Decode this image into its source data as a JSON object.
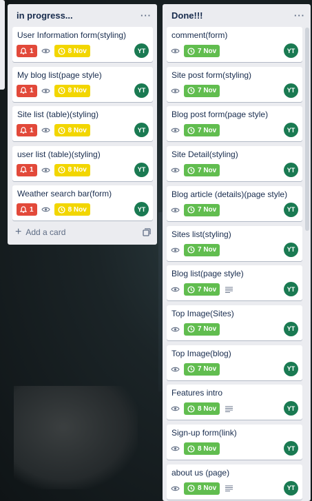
{
  "lists": [
    {
      "title": "in progress...",
      "add_card_label": "Add a card",
      "cards": [
        {
          "title": "User Information form(styling)",
          "notifications": "1",
          "due": "8 Nov",
          "due_color": "yellow",
          "member": "YT",
          "has_description": false
        },
        {
          "title": "My blog list(page style)",
          "notifications": "1",
          "due": "8 Nov",
          "due_color": "yellow",
          "member": "YT",
          "has_description": false
        },
        {
          "title": "Site list (table)(styling)",
          "notifications": "1",
          "due": "8 Nov",
          "due_color": "yellow",
          "member": "YT",
          "has_description": false
        },
        {
          "title": "user list (table)(styling)",
          "notifications": "1",
          "due": "8 Nov",
          "due_color": "yellow",
          "member": "YT",
          "has_description": false
        },
        {
          "title": "Weather search bar(form)",
          "notifications": "1",
          "due": "8 Nov",
          "due_color": "yellow",
          "member": "YT",
          "has_description": false
        }
      ]
    },
    {
      "title": "Done!!!",
      "cards": [
        {
          "title": "comment(form)",
          "due": "7 Nov",
          "due_color": "green",
          "member": "YT",
          "has_description": false
        },
        {
          "title": "Site post form(styling)",
          "due": "7 Nov",
          "due_color": "green",
          "member": "YT",
          "has_description": false
        },
        {
          "title": "Blog post form(page style)",
          "due": "7 Nov",
          "due_color": "green",
          "member": "YT",
          "has_description": false
        },
        {
          "title": "Site Detail(styling)",
          "due": "7 Nov",
          "due_color": "green",
          "member": "YT",
          "has_description": false
        },
        {
          "title": "Blog article (details)(page style)",
          "due": "7 Nov",
          "due_color": "green",
          "member": "YT",
          "has_description": false
        },
        {
          "title": "Sites list(styling)",
          "due": "7 Nov",
          "due_color": "green",
          "member": "YT",
          "has_description": false
        },
        {
          "title": "Blog list(page style)",
          "due": "7 Nov",
          "due_color": "green",
          "member": "YT",
          "has_description": true
        },
        {
          "title": "Top Image(Sites)",
          "due": "7 Nov",
          "due_color": "green",
          "member": "YT",
          "has_description": false
        },
        {
          "title": "Top Image(blog)",
          "due": "7 Nov",
          "due_color": "green",
          "member": "YT",
          "has_description": false
        },
        {
          "title": "Features intro",
          "due": "8 Nov",
          "due_color": "green",
          "member": "YT",
          "has_description": true
        },
        {
          "title": "Sign-up form(link)",
          "due": "8 Nov",
          "due_color": "green",
          "member": "YT",
          "has_description": false
        },
        {
          "title": "about us (page)",
          "due": "8 Nov",
          "due_color": "green",
          "member": "YT",
          "has_description": true
        }
      ]
    }
  ],
  "colors": {
    "red": "#e2493a",
    "yellow": "#f2d600",
    "green": "#61bd4f",
    "avatar": "#1a7a52"
  }
}
